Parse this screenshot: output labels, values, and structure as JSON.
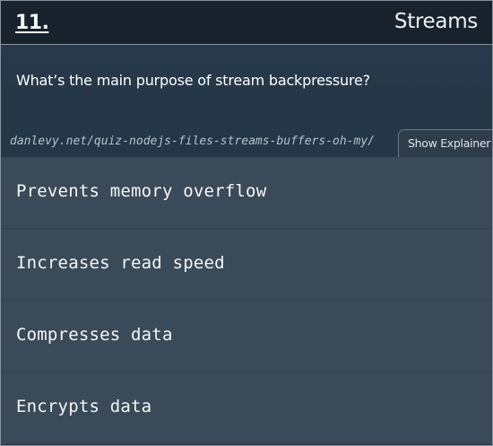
{
  "header": {
    "question_number": "11.",
    "category": "Streams"
  },
  "question": {
    "text": "What’s the main purpose of stream backpressure?",
    "source_link": "danlevy.net/quiz-nodejs-files-streams-buffers-oh-my/",
    "explainer_button": "Show Explainer"
  },
  "options": [
    {
      "label": "Prevents memory overflow"
    },
    {
      "label": "Increases read speed"
    },
    {
      "label": "Compresses data"
    },
    {
      "label": "Encrypts data"
    }
  ],
  "colors": {
    "header_bg": "#17222d",
    "question_bg": "#27394a",
    "option_bg": "#3b4a58",
    "text": "#ffffff"
  }
}
